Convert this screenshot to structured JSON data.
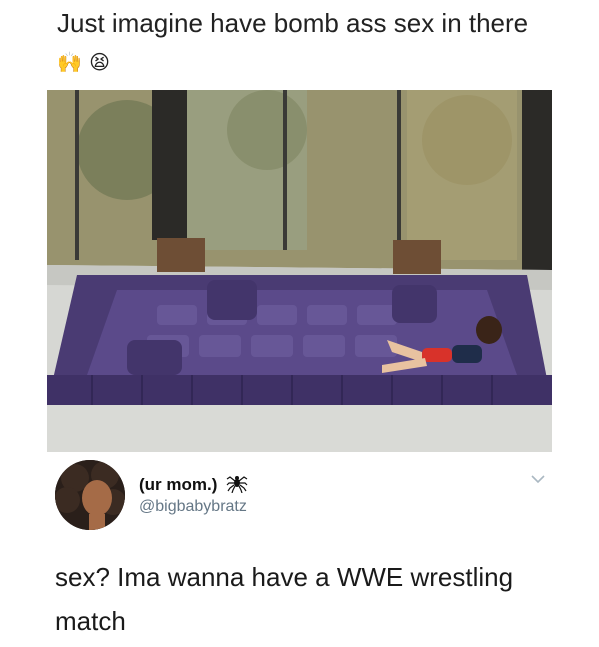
{
  "caption": {
    "text": "Just imagine have bomb ass sex in there",
    "emojis": [
      "🙌",
      "😫"
    ]
  },
  "photo": {
    "subject": "sunken-purple-sectional-sofa"
  },
  "tweet": {
    "display_name": "(ur mom.)",
    "name_emoji": "spider-icon",
    "handle": "@bigbabybratz",
    "text": "sex? Ima wanna have a WWE wrestling match"
  },
  "colors": {
    "sofa_purple": "#5b4a8a",
    "handle_gray": "#657786",
    "text": "#1a1a1a"
  }
}
